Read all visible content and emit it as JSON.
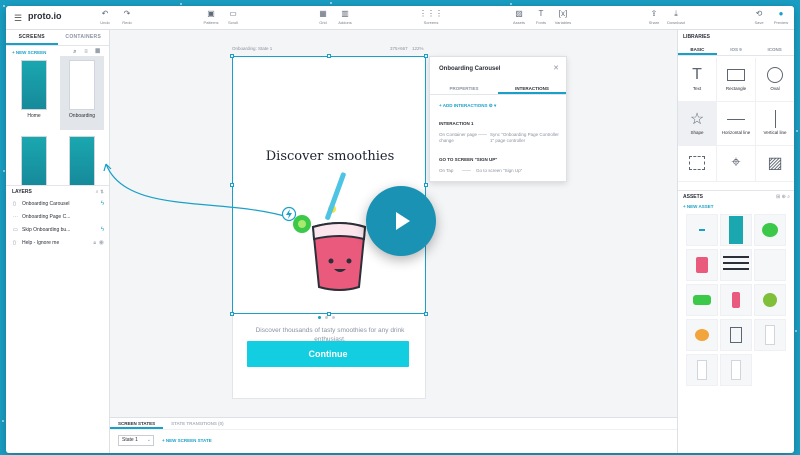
{
  "app": {
    "logo": "proto.io"
  },
  "toolbar": {
    "undo": "Undo",
    "redo": "Redo",
    "patterns": "Patterns",
    "scroll": "Scroll",
    "grid": "Grid",
    "addons": "Addons",
    "screens": "Screens",
    "assets": "Assets",
    "fonts": "Fonts",
    "variables": "Variables",
    "share": "Share",
    "download": "Download",
    "save": "Save",
    "preview": "Preview"
  },
  "left": {
    "tabs": [
      "SCREENS",
      "CONTAINERS"
    ],
    "new_screen": "+ NEW SCREEN",
    "screens": [
      {
        "label": "Home"
      },
      {
        "label": "Onboarding"
      },
      {
        "label": ""
      },
      {
        "label": ""
      }
    ],
    "layers_title": "LAYERS",
    "layers": [
      {
        "label": "Onboarding Carousel"
      },
      {
        "label": "Onboarding Page C..."
      },
      {
        "label": "Skip Onboarding bu..."
      },
      {
        "label": "Help - Ignore me"
      }
    ]
  },
  "canvas": {
    "screen_label": "Onboarding: State 1",
    "dims": "375×667",
    "zoom": "122%",
    "heading": "Discover smoothies",
    "subtext": "Discover thousands of tasty smoothies for any drink enthusiast.",
    "continue_label": "Continue",
    "page_dots": {
      "count": 3,
      "active": 1
    }
  },
  "interactions_panel": {
    "title": "Onboarding Carousel",
    "tabs": [
      "PROPERTIES",
      "INTERACTIONS"
    ],
    "add": "+ ADD INTERACTIONS",
    "interaction1_title": "INTERACTION 1",
    "interaction1_trigger": "On Container page change",
    "interaction1_action": "Sync \"Onboarding Page Controller 1\" page controller",
    "goto_title": "GO TO SCREEN \"SIGN UP\"",
    "goto_trigger": "On Tap",
    "goto_action": "Go to screen \"Sign Up\""
  },
  "right": {
    "libraries_title": "LIBRARIES",
    "lib_tabs": [
      "BASIC",
      "IOS 9",
      "ICONS"
    ],
    "shapes": [
      {
        "label": "Text",
        "icon": "text-icon"
      },
      {
        "label": "Rectangle",
        "icon": "rectangle-icon"
      },
      {
        "label": "Oval",
        "icon": "oval-icon"
      },
      {
        "label": "Shape",
        "icon": "star-icon"
      },
      {
        "label": "Horizontal line",
        "icon": "hline-icon"
      },
      {
        "label": "Vertical line",
        "icon": "vline-icon"
      }
    ],
    "assets_title": "ASSETS",
    "new_asset": "+ NEW ASSET"
  },
  "bottom": {
    "tabs": [
      "SCREEN STATES",
      "STATE TRANSITIONS (0)"
    ],
    "state_value": "State 1",
    "new_state": "+ NEW SCREEN STATE"
  },
  "colors": {
    "accent": "#1aa0c8",
    "button": "#13cde0",
    "background": "#1a9fc4",
    "play": "#1a92b4"
  }
}
